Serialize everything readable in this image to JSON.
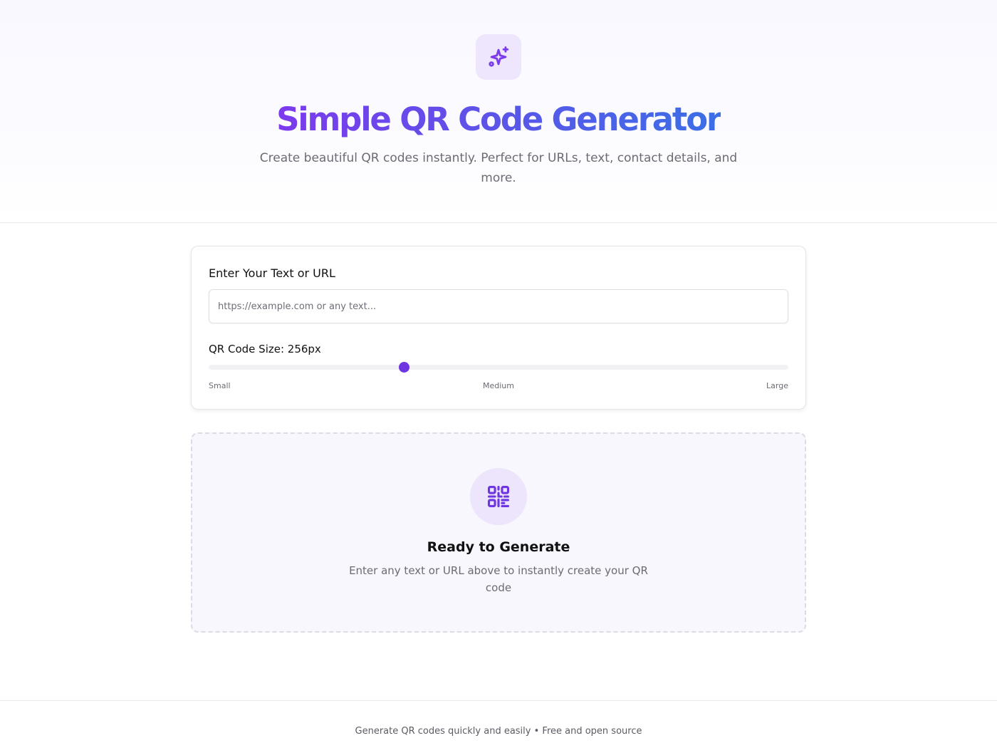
{
  "hero": {
    "icon": "sparkles-icon",
    "title": "Simple QR Code Generator",
    "subtitle": "Create beautiful QR codes instantly. Perfect for URLs, text, contact details, and more."
  },
  "input_card": {
    "label": "Enter Your Text or URL",
    "input_value": "",
    "input_placeholder": "https://example.com or any text...",
    "size_label": "QR Code Size: 256px",
    "slider": {
      "value_fraction": 0.337,
      "scale_labels": [
        "Small",
        "Medium",
        "Large"
      ]
    }
  },
  "placeholder_panel": {
    "icon": "qr-code-icon",
    "title": "Ready to Generate",
    "subtitle": "Enter any text or URL above to instantly create your QR code"
  },
  "footer": {
    "text": "Generate QR codes quickly and easily • Free and open source"
  },
  "colors": {
    "accent": "#6d36e0",
    "gradient_start": "#7c3aed",
    "gradient_end": "#3b6fe6",
    "icon_bg": "#ede6fc"
  }
}
